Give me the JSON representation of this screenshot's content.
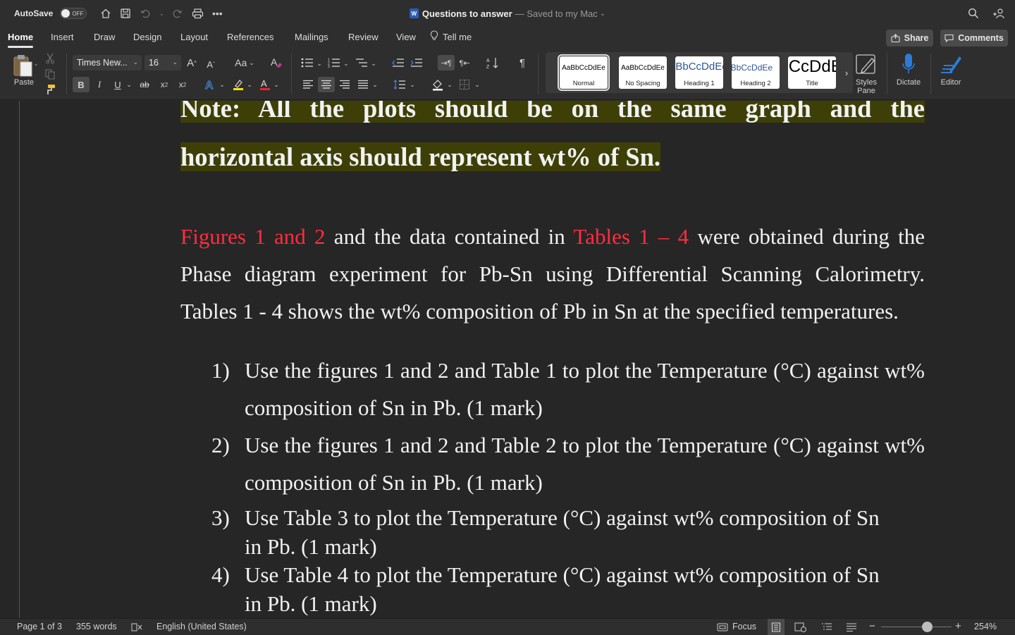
{
  "titlebar": {
    "autosave_label": "AutoSave",
    "autosave_state": "OFF",
    "doc_name": "Questions to answer",
    "saved_status": "— Saved to my Mac",
    "icons": [
      "home-icon",
      "save-icon",
      "undo-icon",
      "redo-icon",
      "print-icon",
      "more-icon",
      "search-icon",
      "share-people-icon"
    ]
  },
  "tabs": [
    {
      "label": "Home",
      "active": true
    },
    {
      "label": "Insert"
    },
    {
      "label": "Draw"
    },
    {
      "label": "Design"
    },
    {
      "label": "Layout"
    },
    {
      "label": "References"
    },
    {
      "label": "Mailings"
    },
    {
      "label": "Review"
    },
    {
      "label": "View"
    },
    {
      "label": "Tell me"
    }
  ],
  "actions": {
    "share": "Share",
    "comments": "Comments"
  },
  "ribbon": {
    "paste": "Paste",
    "font_name": "Times New...",
    "font_size": "16",
    "change_case": "Aa",
    "styles": [
      {
        "preview": "AaBbCcDdEe",
        "label": "Normal",
        "selected": true
      },
      {
        "preview": "AaBbCcDdEe",
        "label": "No Spacing"
      },
      {
        "preview": "AaBbCcDdEe",
        "label": "Heading 1"
      },
      {
        "preview": "AaBbCcDdEe",
        "label": "Heading 2"
      },
      {
        "preview": "AaBbCcDdEe",
        "label": "Title"
      }
    ],
    "styles_pane": "Styles Pane",
    "dictate": "Dictate",
    "editor": "Editor",
    "colors": {
      "highlight": "#f5e400",
      "font_color": "#e8262e",
      "accent": "#2d7bd6"
    }
  },
  "document": {
    "note_line1": "Note: All the plots should be on the same graph and the",
    "note_line2": "horizontal axis should represent wt% of Sn.",
    "para_red1": "Figures 1 and 2",
    "para_text1": " and the data contained in ",
    "para_red2": "Tables 1 – 4",
    "para_text2": " were obtained during the Phase diagram experiment for Pb-Sn using Differential Scanning Calorimetry. Tables 1 - 4 shows the wt% composition of Pb in Sn at the specified temperatures.",
    "items": [
      {
        "num": "1)",
        "text": "Use the figures 1 and 2 and Table 1 to plot the Temperature (°C) against wt% composition of Sn in Pb. (1 mark)"
      },
      {
        "num": "2)",
        "text": "Use the figures 1 and 2 and Table 2 to plot the Temperature (°C) against wt% composition of Sn in Pb. (1 mark)"
      },
      {
        "num": "3)",
        "text": "Use Table 3 to plot the Temperature (°C) against wt% composition of Sn in Pb. (1 mark)"
      },
      {
        "num": "4)",
        "text": "Use Table 4 to plot the Temperature (°C) against wt% composition of Sn in Pb. (1 mark)"
      }
    ]
  },
  "status": {
    "page": "Page 1 of 3",
    "words": "355 words",
    "language": "English (United States)",
    "focus": "Focus",
    "zoom": "254%",
    "zoom_value": 254
  }
}
